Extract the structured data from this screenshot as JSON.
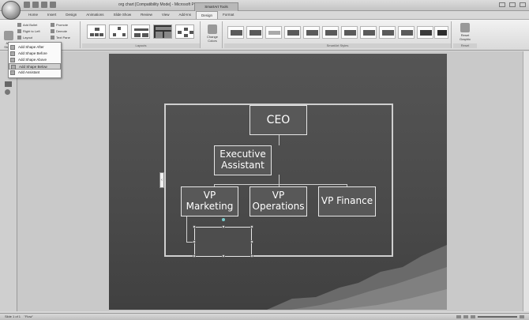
{
  "window": {
    "title": "org chart [Compatibility Mode] - Microsoft PowerPoint",
    "context_tab_group": "SmartArt Tools"
  },
  "tabs": [
    {
      "label": "Home",
      "active": false
    },
    {
      "label": "Insert",
      "active": false
    },
    {
      "label": "Design",
      "active": false
    },
    {
      "label": "Animations",
      "active": false
    },
    {
      "label": "Slide Show",
      "active": false
    },
    {
      "label": "Review",
      "active": false
    },
    {
      "label": "View",
      "active": false
    },
    {
      "label": "Add-Ins",
      "active": false
    },
    {
      "label": "Design",
      "active": true
    },
    {
      "label": "Format",
      "active": false
    }
  ],
  "ribbon": {
    "create_graphic": {
      "add_shape": "Add Shape",
      "add_bullet": "Add Bullet",
      "right_to_left": "Right to Left",
      "layout": "Layout",
      "promote": "Promote",
      "demote": "Demote",
      "text_pane": "Text Pane"
    },
    "layouts_label": "Layouts",
    "change_colors": "Change Colors",
    "smartart_styles_label": "SmartArt Styles",
    "reset_graphic": "Reset Graphic",
    "reset_label": "Reset"
  },
  "menu": {
    "items": [
      {
        "label": "Add Shape After",
        "highlighted": false
      },
      {
        "label": "Add Shape Before",
        "highlighted": false
      },
      {
        "label": "Add Shape Above",
        "highlighted": false
      },
      {
        "label": "Add Shape Below",
        "highlighted": true
      },
      {
        "label": "Add Assistant",
        "highlighted": false
      }
    ]
  },
  "chart": {
    "ceo": "CEO",
    "executive_assistant": "Executive\nAssistant",
    "vp_marketing": "VP\nMarketing",
    "vp_operations": "VP\nOperations",
    "vp_finance": "VP Finance"
  },
  "status": {
    "slide_info": "Slide 1 of 1",
    "theme": "\"Flow\""
  },
  "colors": {
    "slide_bg": "#4a4a4a",
    "node_fill": "#585858",
    "node_border": "#e6e6e6"
  }
}
